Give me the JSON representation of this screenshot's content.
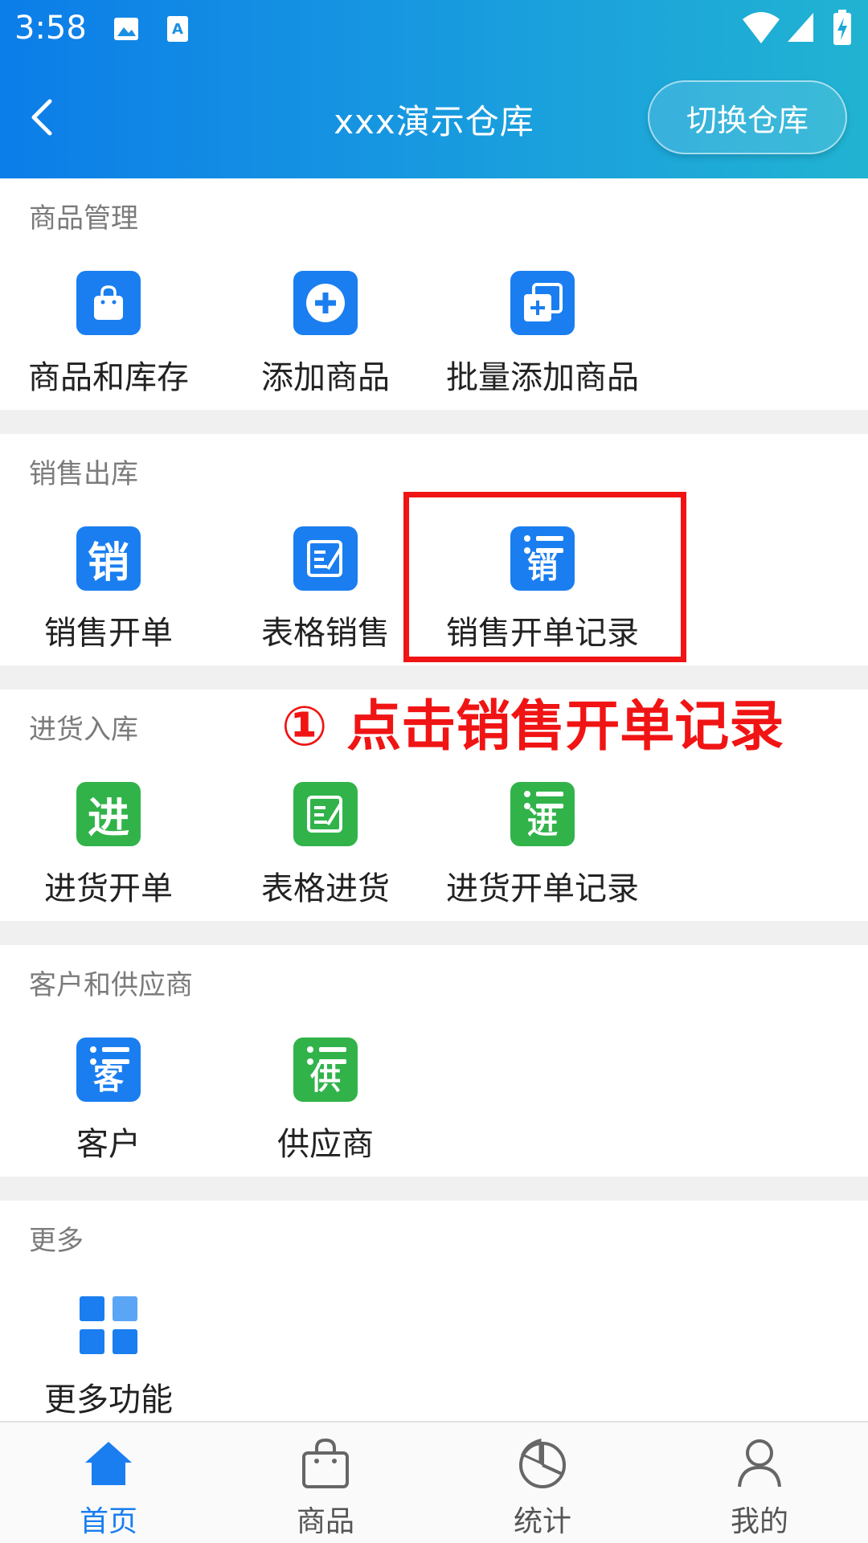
{
  "status_bar": {
    "time": "3:58"
  },
  "header": {
    "title": "xxx演示仓库",
    "switch_label": "切换仓库"
  },
  "sections": [
    {
      "title": "商品管理",
      "items": [
        {
          "label": "商品和库存",
          "icon": "shopping-bag-icon",
          "color": "#1a7ef0"
        },
        {
          "label": "添加商品",
          "icon": "plus-circle-icon",
          "color": "#1a7ef0"
        },
        {
          "label": "批量添加商品",
          "icon": "batch-add-icon",
          "color": "#1a7ef0"
        }
      ]
    },
    {
      "title": "销售出库",
      "items": [
        {
          "label": "销售开单",
          "icon": "sales-order-icon",
          "glyph": "销",
          "color": "#1a7ef0"
        },
        {
          "label": "表格销售",
          "icon": "table-edit-icon",
          "color": "#1a7ef0"
        },
        {
          "label": "销售开单记录",
          "icon": "sales-record-icon",
          "glyph": "销",
          "color": "#1a7ef0"
        }
      ]
    },
    {
      "title": "进货入库",
      "items": [
        {
          "label": "进货开单",
          "icon": "purchase-order-icon",
          "glyph": "进",
          "color": "#31b34a"
        },
        {
          "label": "表格进货",
          "icon": "table-edit-icon",
          "color": "#31b34a"
        },
        {
          "label": "进货开单记录",
          "icon": "purchase-record-icon",
          "glyph": "进",
          "color": "#31b34a"
        }
      ]
    },
    {
      "title": "客户和供应商",
      "items": [
        {
          "label": "客户",
          "icon": "customer-icon",
          "glyph": "客",
          "color": "#1a7ef0"
        },
        {
          "label": "供应商",
          "icon": "supplier-icon",
          "glyph": "供",
          "color": "#31b34a"
        }
      ]
    },
    {
      "title": "更多",
      "items": [
        {
          "label": "更多功能",
          "icon": "grid-icon",
          "color": "#1a7ef0"
        }
      ]
    }
  ],
  "annotation": "① 点击销售开单记录",
  "bottom_nav": [
    {
      "label": "首页",
      "icon": "home-icon",
      "active": true
    },
    {
      "label": "商品",
      "icon": "bag-icon",
      "active": false
    },
    {
      "label": "统计",
      "icon": "pie-chart-icon",
      "active": false
    },
    {
      "label": "我的",
      "icon": "user-icon",
      "active": false
    }
  ],
  "colors": {
    "accent": "#1a7ef0",
    "green": "#31b34a",
    "highlight": "#f01414"
  }
}
